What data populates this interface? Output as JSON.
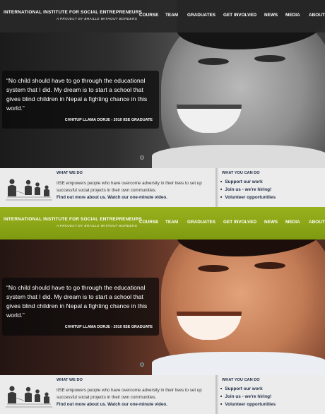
{
  "site": {
    "title": "INTERNATIONAL INSTITUTE FOR SOCIAL ENTREPRENEURS",
    "subtitle": "A PROJECT BY BRAILLE WITHOUT BORDERS"
  },
  "nav": [
    "COURSE",
    "TEAM",
    "GRADUATES",
    "GET INVOLVED",
    "NEWS",
    "MEDIA",
    "ABOUT"
  ],
  "quote": {
    "text": "“No child should have to go through the educational system that I did. My dream is to start a school that gives blind children in Nepal a fighting chance in this world.”",
    "cite": "CHHITUP LLAMA DORJE - 2010 IISE GRADUATE"
  },
  "what_we_do": {
    "title": "WHAT WE DO",
    "body": "IISE empowers people who have overcome adversity in their lives to set up successful social projects in their own communities.",
    "link": "Find out more about us. Watch our one-minute video."
  },
  "what_you_can_do": {
    "title": "WHAT YOU CAN DO",
    "items": [
      "Support our work",
      "Join us - we're hiring!",
      "Volunteer opportunities"
    ]
  },
  "colors": {
    "topbar_variant1": "#2a2a2a",
    "topbar_variant2": "#8ca81a",
    "link": "#1f2c45"
  },
  "icons": [
    "people-silhouettes-icon",
    "slide-indicator-dot"
  ]
}
